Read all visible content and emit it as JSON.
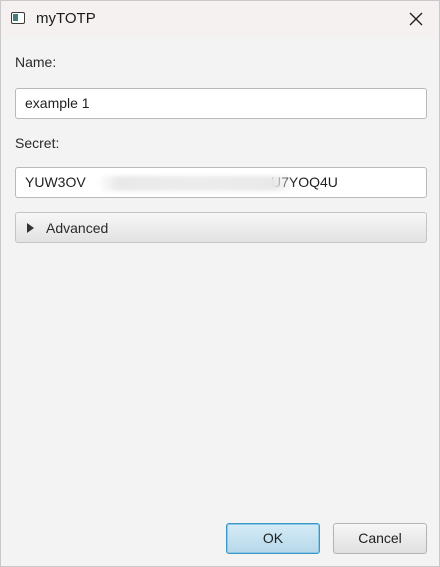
{
  "window": {
    "title": "myTOTP",
    "icons": {
      "app": "app-window-icon",
      "close": "close-icon"
    }
  },
  "form": {
    "name_label": "Name:",
    "name_value": "example 1",
    "secret_label": "Secret:",
    "secret_value_prefix": "YUW3OV",
    "secret_value_suffix": "U7YOQ4U",
    "advanced_label": "Advanced",
    "advanced_expanded": false
  },
  "buttons": {
    "ok_label": "OK",
    "cancel_label": "Cancel"
  },
  "colors": {
    "titlebar_bg": "#f6f1f1",
    "content_bg": "#f3f3f3",
    "ok_border": "#3b97c8",
    "ok_bg": "#c6e2f0"
  }
}
